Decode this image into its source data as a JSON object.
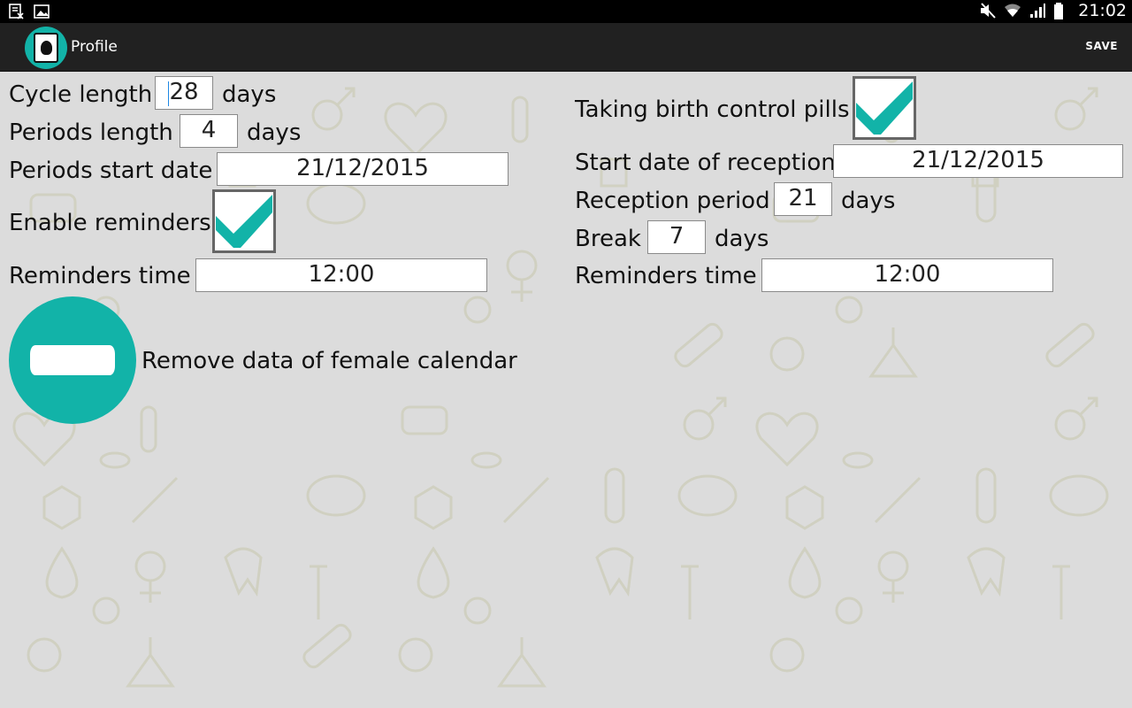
{
  "status_bar": {
    "time": "21:02",
    "icons": [
      "doc-x-icon",
      "image-icon",
      "mute-icon",
      "wifi-icon",
      "signal-icon",
      "battery-icon"
    ]
  },
  "action_bar": {
    "title": "Profile",
    "save_label": "SAVE"
  },
  "left": {
    "cycle_length_label": "Cycle length",
    "cycle_length_value": "28",
    "cycle_length_unit": "days",
    "periods_length_label": "Periods length",
    "periods_length_value": "4",
    "periods_length_unit": "days",
    "periods_start_label": "Periods start date",
    "periods_start_value": "21/12/2015",
    "enable_reminders_label": "Enable reminders",
    "enable_reminders_checked": true,
    "reminders_time_label": "Reminders time",
    "reminders_time_value": "12:00",
    "remove_label": "Remove data of female calendar"
  },
  "right": {
    "birth_control_label": "Taking birth control pills",
    "birth_control_checked": true,
    "start_reception_label": "Start date of reception",
    "start_reception_value": "21/12/2015",
    "reception_period_label": "Reception period",
    "reception_period_value": "21",
    "reception_period_unit": "days",
    "break_label": "Break",
    "break_value": "7",
    "break_unit": "days",
    "reminders_time_label": "Reminders time",
    "reminders_time_value": "12:00"
  },
  "colors": {
    "accent": "#12b3a8",
    "action_bar": "#212121",
    "background": "#dcdcdc"
  }
}
